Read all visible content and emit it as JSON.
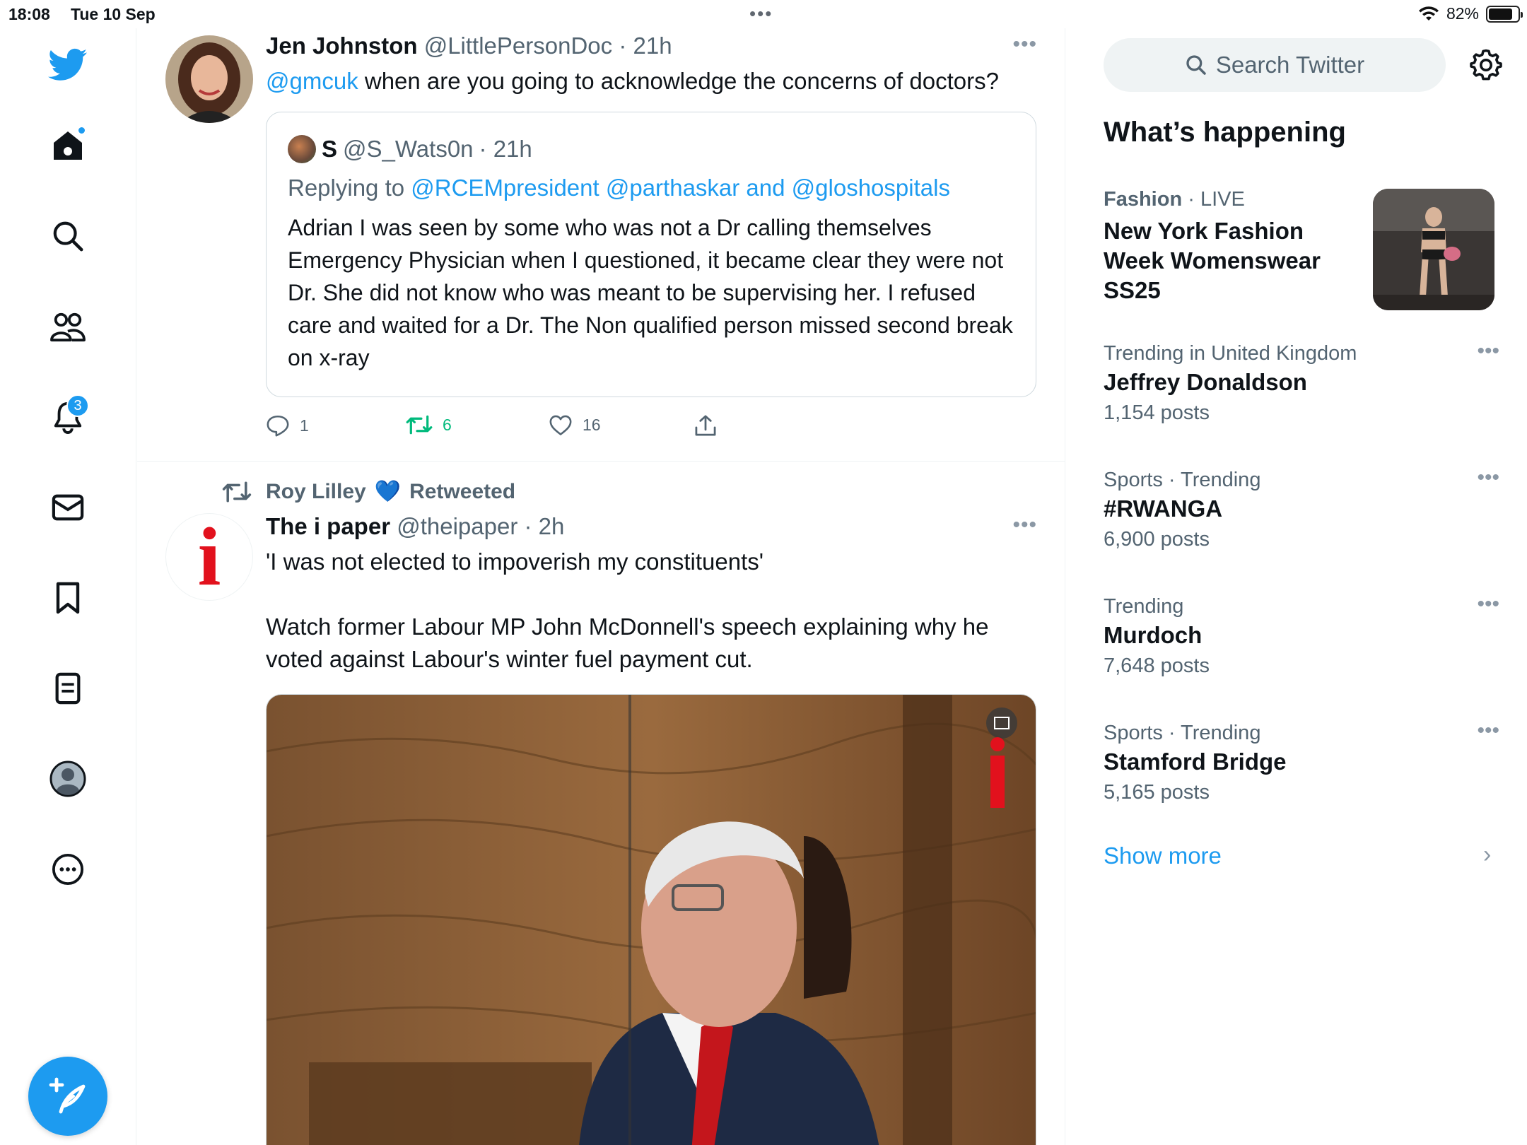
{
  "status_bar": {
    "time": "18:08",
    "date": "Tue 10 Sep",
    "battery": "82%",
    "battery_level": 0.82,
    "multitask_dots": "•••"
  },
  "nav": {
    "items": [
      {
        "name": "logo",
        "icon": "twitter-bird-icon"
      },
      {
        "name": "home",
        "icon": "home-icon"
      },
      {
        "name": "explore",
        "icon": "search-icon"
      },
      {
        "name": "communities",
        "icon": "people-icon"
      },
      {
        "name": "notifications",
        "icon": "bell-icon",
        "badge": "3"
      },
      {
        "name": "messages",
        "icon": "mail-icon"
      },
      {
        "name": "bookmarks",
        "icon": "bookmark-icon"
      },
      {
        "name": "lists",
        "icon": "list-icon"
      },
      {
        "name": "profile",
        "icon": "avatar-icon"
      },
      {
        "name": "more",
        "icon": "more-icon"
      }
    ],
    "notification_badge": "3",
    "compose_icon": "compose-icon",
    "accent": "#1d9bf0"
  },
  "tweets": [
    {
      "name": "Jen Johnston",
      "handle": "@LittlePersonDoc",
      "time": "· 21h",
      "text_link": "@gmcuk",
      "text_rest": " when are you going to acknowledge the concerns of doctors?",
      "quote": {
        "name": "S",
        "handle": "@S_Wats0n",
        "time": "· 21h",
        "replying_prefix": "Replying to ",
        "replying_users": "@RCEMpresident @parthaskar and @gloshospitals",
        "text": "Adrian I was seen by some who was not a Dr calling themselves Emergency Physician when I questioned, it became clear they were not  Dr. She did not know who was meant to be supervising her. I refused care and waited for a Dr. The Non qualified person missed second break on x-ray"
      },
      "replies": "1",
      "retweets": "6",
      "likes": "16"
    },
    {
      "retweeted_by": "Roy Lilley",
      "retweeted_emoji": "💙",
      "retweeted_label": "Retweeted",
      "name": "The i paper",
      "handle": "@theipaper",
      "time": "· 2h",
      "text_line1": "'I was not elected to impoverish my constituents'",
      "text_line2": "Watch former Labour MP John McDonnell's speech explaining why he voted against Labour's winter fuel payment cut.",
      "avatar_letter": "i"
    }
  ],
  "more_dots": "•••",
  "sidebar": {
    "search_placeholder": "Search Twitter",
    "section_title": "What’s happening",
    "trends": [
      {
        "category": "Fashion",
        "sep": " · ",
        "status": "LIVE",
        "title": "New York Fashion Week Womenswear SS25",
        "count": ""
      },
      {
        "category": "Trending in United Kingdom",
        "sep": "",
        "status": "",
        "title": "Jeffrey Donaldson",
        "count": "1,154 posts"
      },
      {
        "category": "Sports · Trending",
        "sep": "",
        "status": "",
        "title": "#RWANGA",
        "count": "6,900 posts"
      },
      {
        "category": "Trending",
        "sep": "",
        "status": "",
        "title": "Murdoch",
        "count": "7,648 posts"
      },
      {
        "category": "Sports · Trending",
        "sep": "",
        "status": "",
        "title": "Stamford Bridge",
        "count": "5,165 posts"
      }
    ],
    "show_more": "Show more",
    "chevron": "›"
  }
}
